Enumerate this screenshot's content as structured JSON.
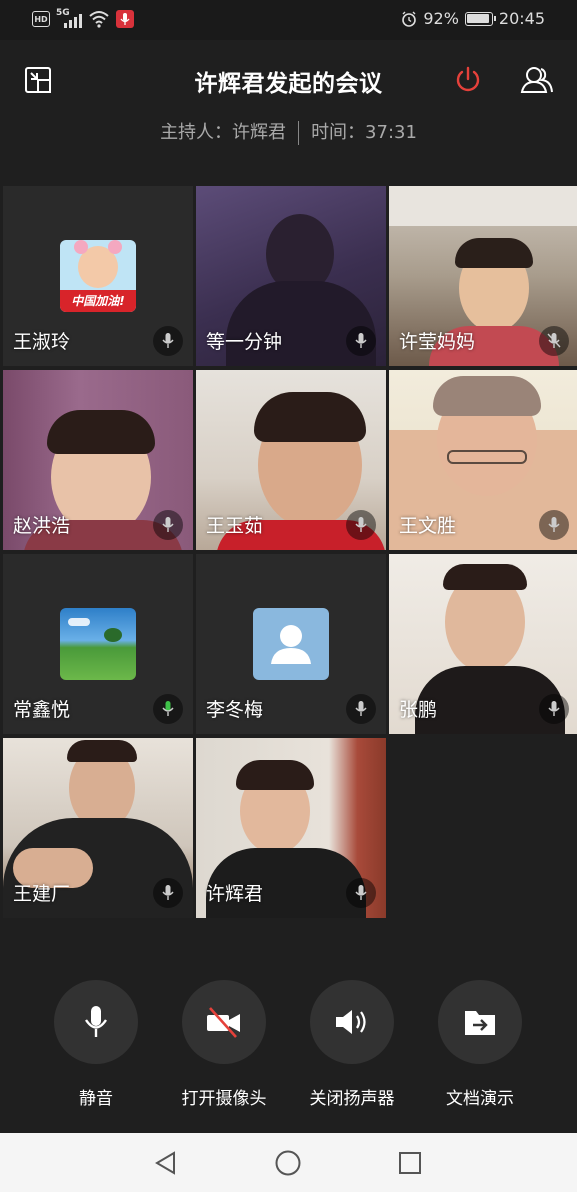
{
  "status_bar": {
    "hd": "HD",
    "network": "5G",
    "battery_percent": "92%",
    "battery_level": 0.92,
    "time": "20:45"
  },
  "header": {
    "title": "许辉君发起的会议",
    "host_label": "主持人：许辉君",
    "time_label": "时间：37:31",
    "end_color": "#e5413b"
  },
  "participants": [
    {
      "name": "王淑玲",
      "video": false,
      "avatar": "child-photo-avatar",
      "avatar_caption": "中国加油!",
      "mic": "on"
    },
    {
      "name": "等一分钟",
      "video": true,
      "mic": "on"
    },
    {
      "name": "许莹妈妈",
      "video": true,
      "mic": "muted"
    },
    {
      "name": "赵洪浩",
      "video": true,
      "mic": "on"
    },
    {
      "name": "王玉茹",
      "video": true,
      "mic": "on"
    },
    {
      "name": "王文胜",
      "video": true,
      "mic": "on"
    },
    {
      "name": "常鑫悦",
      "video": false,
      "avatar": "landscape-avatar",
      "mic": "speaking"
    },
    {
      "name": "李冬梅",
      "video": false,
      "avatar": "default-user-avatar",
      "mic": "on"
    },
    {
      "name": "张鹏",
      "video": true,
      "mic": "on"
    },
    {
      "name": "王建厂",
      "video": true,
      "mic": "on"
    },
    {
      "name": "许辉君",
      "video": true,
      "mic": "on"
    }
  ],
  "controls": [
    {
      "label": "静音",
      "icon": "microphone-icon"
    },
    {
      "label": "打开摄像头",
      "icon": "camera-off-icon"
    },
    {
      "label": "关闭扬声器",
      "icon": "speaker-icon"
    },
    {
      "label": "文档演示",
      "icon": "folder-share-icon"
    }
  ],
  "colors": {
    "background": "#1f1f1f",
    "tile": "#2a2a2a",
    "speaking_mic": "#3fc24a",
    "camera_off_slash": "#e5413b"
  }
}
